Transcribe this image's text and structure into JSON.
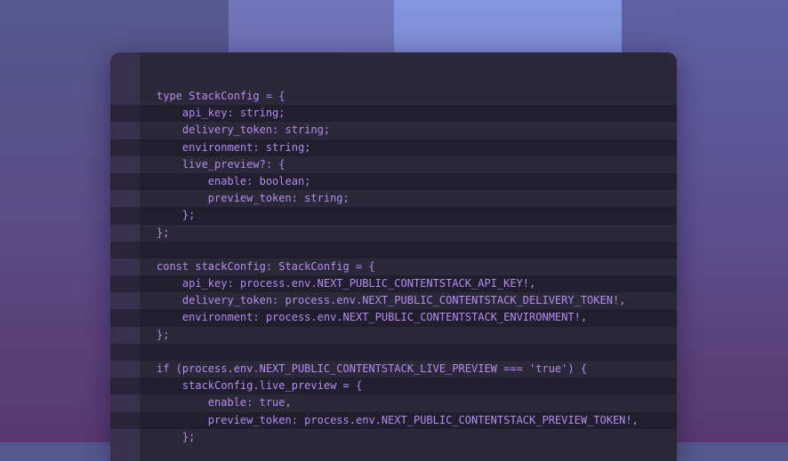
{
  "code": {
    "lines": [
      "type StackConfig = {",
      "    api_key: string;",
      "    delivery_token: string;",
      "    environment: string;",
      "    live_preview?: {",
      "        enable: boolean;",
      "        preview_token: string;",
      "    };",
      "};",
      "",
      "const stackConfig: StackConfig = {",
      "    api_key: process.env.NEXT_PUBLIC_CONTENTSTACK_API_KEY!,",
      "    delivery_token: process.env.NEXT_PUBLIC_CONTENTSTACK_DELIVERY_TOKEN!,",
      "    environment: process.env.NEXT_PUBLIC_CONTENTSTACK_ENVIRONMENT!,",
      "};",
      "",
      "if (process.env.NEXT_PUBLIC_CONTENTSTACK_LIVE_PREVIEW === 'true') {",
      "    stackConfig.live_preview = {",
      "        enable: true,",
      "        preview_token: process.env.NEXT_PUBLIC_CONTENTSTACK_PREVIEW_TOKEN!,",
      "    };"
    ]
  },
  "colors": {
    "code_text": "#b48cf0",
    "window_background": "#2b2838"
  }
}
